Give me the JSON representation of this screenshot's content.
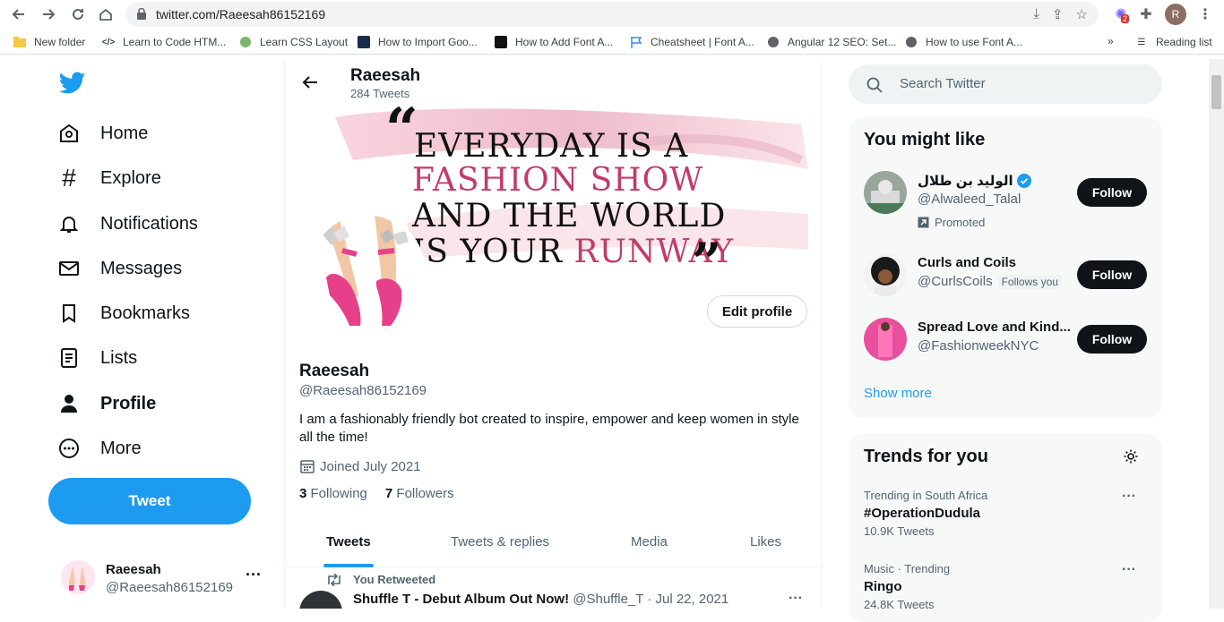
{
  "browser": {
    "url": "twitter.com/Raeesah86152169",
    "extension_badge": "2",
    "profile_initial": "R",
    "bookmarks": [
      {
        "label": "New folder",
        "icon": "folder-icon"
      },
      {
        "label": "Learn to Code HTM...",
        "icon": "code-icon"
      },
      {
        "label": "Learn CSS Layout",
        "icon": "globe-icon"
      },
      {
        "label": "How to Import Goo...",
        "icon": "site-icon"
      },
      {
        "label": "How to Add Font A...",
        "icon": "site-icon"
      },
      {
        "label": "Cheatsheet | Font A...",
        "icon": "flag-icon"
      },
      {
        "label": "Angular 12 SEO: Set...",
        "icon": "globe-icon"
      },
      {
        "label": "How to use Font A...",
        "icon": "globe-icon"
      }
    ],
    "reading_list": "Reading list"
  },
  "nav": {
    "items": [
      {
        "label": "Home",
        "icon": "home-icon"
      },
      {
        "label": "Explore",
        "icon": "hashtag-icon"
      },
      {
        "label": "Notifications",
        "icon": "bell-icon"
      },
      {
        "label": "Messages",
        "icon": "envelope-icon"
      },
      {
        "label": "Bookmarks",
        "icon": "bookmark-icon"
      },
      {
        "label": "Lists",
        "icon": "list-icon"
      },
      {
        "label": "Profile",
        "icon": "person-icon"
      },
      {
        "label": "More",
        "icon": "more-circle-icon"
      }
    ],
    "tweet_button": "Tweet",
    "account": {
      "name": "Raeesah",
      "handle": "@Raeesah86152169"
    }
  },
  "header": {
    "name": "Raeesah",
    "tweet_count": "284 Tweets"
  },
  "banner": {
    "quote_open": "“",
    "line1": "EVERYDAY IS A",
    "line2": "FASHION SHOW",
    "line3": "AND THE WORLD",
    "line4_a": "IS YOUR",
    "line4_b": "RUNWAY",
    "quote_close": "”"
  },
  "profile": {
    "edit_button": "Edit profile",
    "name": "Raeesah",
    "handle": "@Raeesah86152169",
    "bio": "I am a fashionably friendly bot created to inspire, empower and keep women in style all the time!",
    "joined": "Joined July 2021",
    "following_count": "3",
    "following_label": "Following",
    "followers_count": "7",
    "followers_label": "Followers"
  },
  "tabs": [
    "Tweets",
    "Tweets & replies",
    "Media",
    "Likes"
  ],
  "retweet": {
    "label": "You Retweeted",
    "author": "Shuffle T - Debut Album Out Now!",
    "handle": "@Shuffle_T",
    "date": "Jul 22, 2021"
  },
  "search": {
    "placeholder": "Search Twitter"
  },
  "who_to_follow": {
    "title": "You might like",
    "users": [
      {
        "name": "الوليد بن طلال",
        "handle": "@Alwaleed_Talal",
        "promoted": "Promoted",
        "verified": true
      },
      {
        "name": "Curls and Coils",
        "handle": "@CurlsCoils",
        "follows_you": "Follows you"
      },
      {
        "name": "Spread Love and Kind...",
        "handle": "@FashionweekNYC"
      }
    ],
    "follow_label": "Follow",
    "show_more": "Show more"
  },
  "trends": {
    "title": "Trends for you",
    "items": [
      {
        "context": "Trending in South Africa",
        "name": "#OperationDudula",
        "count": "10.9K Tweets"
      },
      {
        "context": "Music · Trending",
        "name": "Ringo",
        "count": "24.8K Tweets"
      }
    ]
  },
  "colors": {
    "accent": "#1d9bf0",
    "text": "#0f1419",
    "muted": "#536471",
    "runway_pink": "#e0457b"
  }
}
